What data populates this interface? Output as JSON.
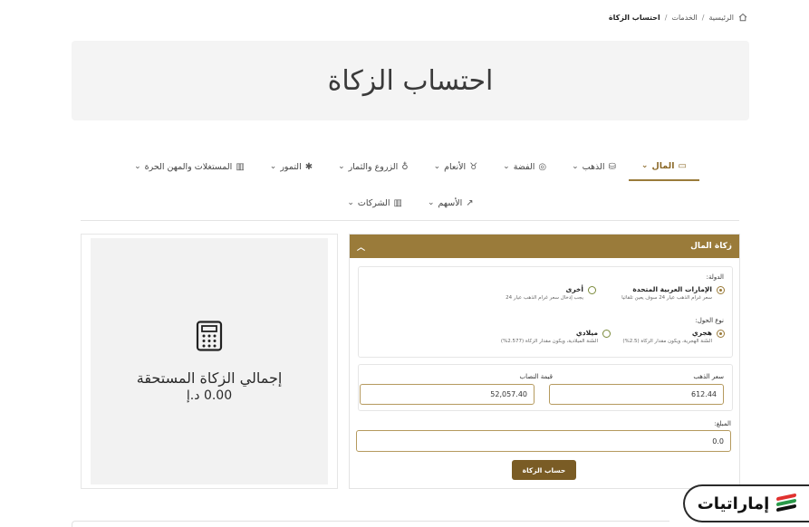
{
  "breadcrumb": {
    "home": "الرئيسية",
    "services": "الخدمات",
    "current": "احتساب الزكاة",
    "separator": "/"
  },
  "page_title": "احتساب الزكاة",
  "tabs_row1": [
    {
      "label": "المال",
      "icon": "money-icon",
      "active": true
    },
    {
      "label": "الذهب",
      "icon": "gold-icon"
    },
    {
      "label": "الفضة",
      "icon": "silver-icon"
    },
    {
      "label": "الأنعام",
      "icon": "livestock-icon"
    },
    {
      "label": "الزروع والثمار",
      "icon": "crops-icon"
    },
    {
      "label": "التمور",
      "icon": "palm-icon"
    },
    {
      "label": "المستغلات والمهن الحرة",
      "icon": "building-icon"
    }
  ],
  "tabs_row2": [
    {
      "label": "الأسهم",
      "icon": "chart-icon"
    },
    {
      "label": "الشركات",
      "icon": "company-icon"
    }
  ],
  "panel": {
    "header": "زكاة المال",
    "country_label": "الدولة:",
    "country_options": [
      {
        "title": "الإمارات العربية المتحدة",
        "sub": "سعر غرام الذهب عيار 24 سوف يعين تلقائيا",
        "selected": true
      },
      {
        "title": "أخرى",
        "sub": "يجب إدخال سعر غرام الذهب عيار 24",
        "selected": false
      }
    ],
    "year_label": "نوع الحول:",
    "year_options": [
      {
        "title": "هجري",
        "sub": "السّنة الهجرية، ويكون مقدار الزكاة (2.5%)",
        "selected": true
      },
      {
        "title": "ميلادي",
        "sub": "السّنة الميلادية، ويكون مقدار الزكاة (2.577%)",
        "selected": false
      }
    ],
    "gold_price_label": "سعر الذهب",
    "gold_price_value": "612.44",
    "nisab_label": "قيمة النصاب",
    "nisab_value": "52,057.40",
    "amount_label": "المبلغ:",
    "amount_value": "0.0",
    "button": "حساب الزكاة"
  },
  "result": {
    "label": "إجمالي الزكاة المستحقة",
    "value": "0.00 د.إ"
  },
  "brand": {
    "name": "إماراتيات",
    "flag_colors": [
      "#e0312f",
      "#2a9a4a",
      "#111111"
    ]
  },
  "colors": {
    "accent": "#9a7b3a",
    "button": "#7a5c25"
  }
}
